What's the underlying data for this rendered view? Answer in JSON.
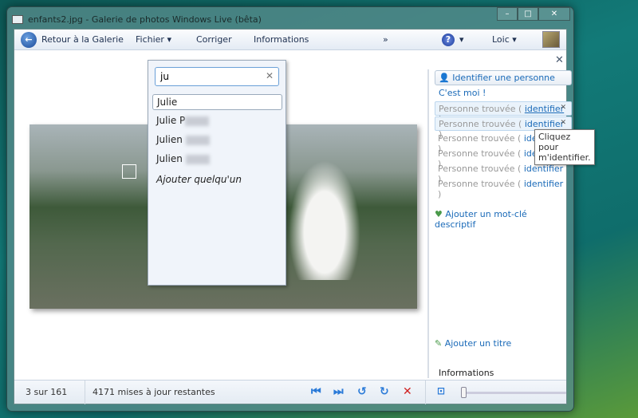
{
  "window": {
    "title": "enfants2.jpg - Galerie de photos Windows Live (bêta)",
    "minimize": "–",
    "maximize": "□",
    "close": "✕"
  },
  "toolbar": {
    "back": "Retour à la Galerie",
    "file": "Fichier ▾",
    "fix": "Corriger",
    "info": "Informations",
    "more": "»",
    "help": "?",
    "help_arrow": "▾",
    "user": "Loic ▾"
  },
  "dropdown": {
    "search_value": "ju",
    "clear": "✕",
    "options": [
      "Julie",
      "Julie P",
      "Julien",
      "Julien"
    ],
    "add": "Ajouter quelqu'un"
  },
  "panel": {
    "close": "✕",
    "identify": "Identifier une personne",
    "me": "C'est moi !",
    "people": [
      {
        "text": "Personne trouvée ( ",
        "link": "identifier",
        "end": " )"
      },
      {
        "text": "Personne trouvée ( ",
        "link": "identifier",
        "end": " )"
      },
      {
        "text": "Personne trouvée ( ",
        "link": "identifier",
        "end": " )"
      },
      {
        "text": "Personne trouvée ( ",
        "link": "identifier",
        "end": " )"
      },
      {
        "text": "Personne trouvée ( ",
        "link": "identifier",
        "end": " )"
      },
      {
        "text": "Personne trouvée ( ",
        "link": "identifier",
        "end": " )"
      }
    ],
    "remove": "✕",
    "tooltip": "Cliquez pour m'identifier.",
    "add_tag": "Ajouter un mot-clé descriptif",
    "add_title": "Ajouter un titre",
    "info": "Informations"
  },
  "status": {
    "position": "3 sur 161",
    "updates": "4171 mises à jour restantes",
    "zoom_level": 0
  }
}
